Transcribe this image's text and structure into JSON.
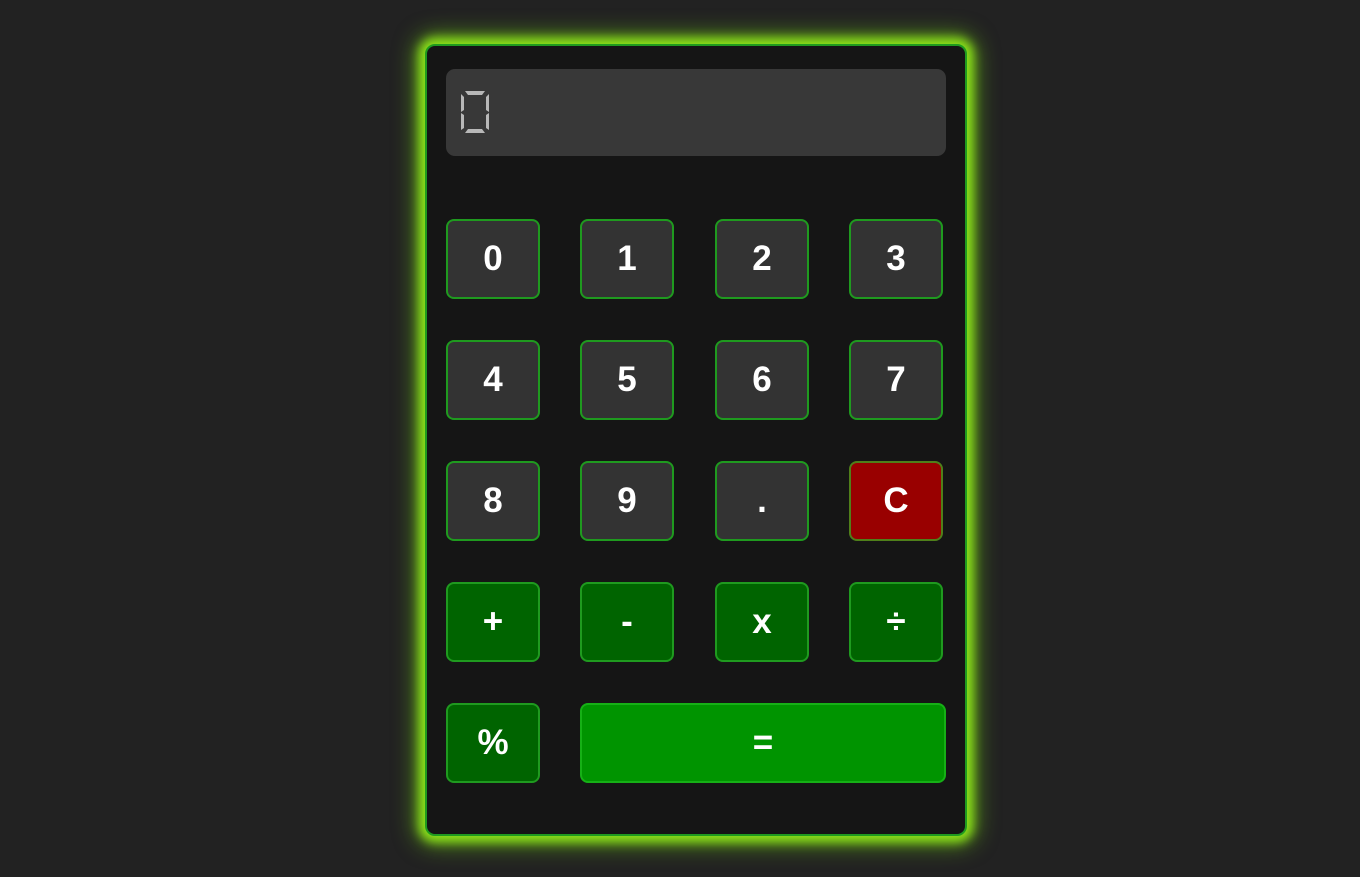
{
  "display": {
    "value": "0",
    "digit_color": "#b8b8b8"
  },
  "keys": {
    "k0": "0",
    "k1": "1",
    "k2": "2",
    "k3": "3",
    "k4": "4",
    "k5": "5",
    "k6": "6",
    "k7": "7",
    "k8": "8",
    "k9": "9",
    "decimal": ".",
    "clear": "C",
    "add": "+",
    "subtract": "-",
    "multiply": "x",
    "divide": "÷",
    "percent": "%",
    "equals": "="
  },
  "colors": {
    "page_background": "#222222",
    "body": "#151515",
    "glow": "#8ce21a",
    "border": "#1f9a1f",
    "number_key": "#333333",
    "operator_key": "#006400",
    "equals_key": "#009400",
    "clear_key": "#990000"
  }
}
